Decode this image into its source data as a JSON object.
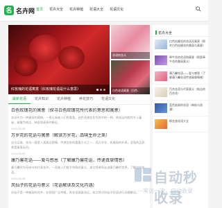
{
  "site": {
    "logo_mark": "名",
    "logo_text": "名卉网"
  },
  "nav": [
    "首页",
    "花卉大全",
    "花卉种植",
    "花语大全",
    "花语文化"
  ],
  "hero": {
    "main_caption": "红玫瑰的花语寓意（红玫瑰花语是什么意思）",
    "side_captions": [
      "花语的含义",
      "白色花语寓意（白色..."
    ]
  },
  "tabs": [
    "最新花语",
    "花卉知识",
    "花卉种植",
    "养花技巧",
    "花语文化"
  ],
  "articles": [
    {
      "title": "白色玫瑰花的寓意（探寻白色玫瑰花所代表的意思和寓意）",
      "text": "花朵作为一种美丽的植物，一直以来被人们所喜爱。白色玫瑰花作为其中的一种，其纯洁的颜色令人着迷，被誉为纯洁、神圣和高贵的象征。",
      "meta": "2024-05-08"
    },
    {
      "title": "万岁花的花语与寓意（解读万岁花，品味生命之美）",
      "text": "自古以来，花朵一直是人类表达感情、传递信息的重要方式之一，而万岁花，其美丽的外表，坚强的品质更是寓意无穷。",
      "meta": "2024-05-08"
    },
    {
      "title": "康乃馨花语——爱与感恩（了解康乃馨花语，传递真挚情感）",
      "text": "康乃馨作为母亲节的代表花卉，一直被人们赋予特殊的意义，本文将带你走进康乃馨的世界，了解它的花语。",
      "meta": "2024-05-08"
    },
    {
      "title": "凤仙子的花语与意义（花语解读及文化内涵）",
      "text": "凤仙子是一种美丽的花卉，在我国广泛种植，其花语寓意深远，本文将对凤仙子花语进行详细解读。",
      "meta": "2024-05-08"
    }
  ],
  "sidebar": {
    "title": "花卉大全",
    "items": [
      "白色桔梗花的花语及寓意（探究白色桔梗花的美丽与寓意）",
      "牵牛花的花语和寓意（探索牵牛花的美丽意义）",
      "康乃馨花语——爱与感恩（了解康乃馨花语传递真挚情感）",
      "百合花语与代表意义（纯洁的百合花）",
      "蓝色妖姬的花语（神秘与浪漫）",
      "郁金香花语大全"
    ]
  },
  "watermark": {
    "main": "自动秒收录",
    "sub": "—来访一次，自动收录"
  },
  "colors": {
    "accent": "#22b14c"
  }
}
